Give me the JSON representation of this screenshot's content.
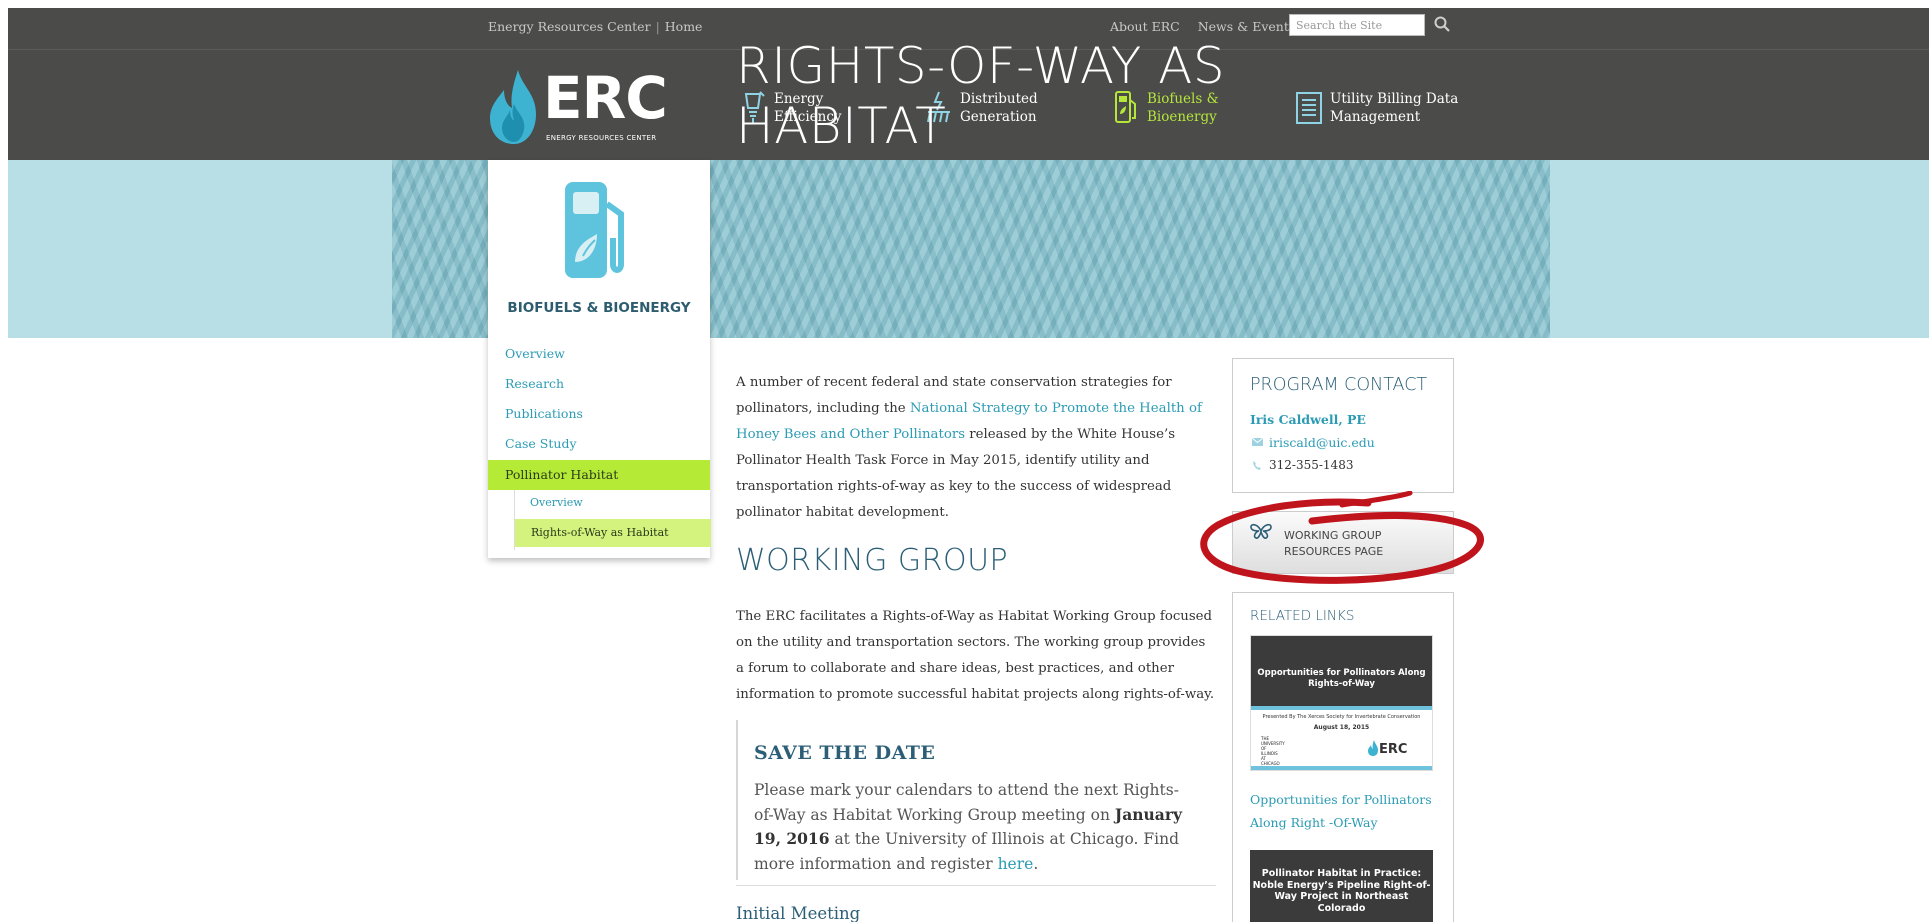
{
  "utility_bar": {
    "crumb_site": "Energy Resources Center",
    "crumb_sep": "|",
    "crumb_home": "Home",
    "link_about": "About ERC",
    "link_news": "News & Events",
    "search_placeholder": "Search the Site"
  },
  "logo": {
    "word": "ERC",
    "subtitle": "ENERGY RESOURCES CENTER"
  },
  "nav": [
    {
      "line1": "Energy",
      "line2": "Efficiency",
      "icon": "lightbulb-icon"
    },
    {
      "line1": "Distributed",
      "line2": "Generation",
      "icon": "power-grid-icon"
    },
    {
      "line1": "Biofuels &",
      "line2": "Bioenergy",
      "icon": "fuel-pump-icon",
      "active": true
    },
    {
      "line1": "Utility Billing Data",
      "line2": "Management",
      "icon": "document-icon"
    }
  ],
  "banner": {
    "title": "RIGHTS-OF-WAY AS HABITAT"
  },
  "sidebar": {
    "section": "BIOFUELS & BIOENERGY",
    "items": [
      "Overview",
      "Research",
      "Publications",
      "Case Study"
    ],
    "active_item": "Pollinator Habitat",
    "sub_items": [
      "Overview",
      "Rights-of-Way as Habitat"
    ]
  },
  "main": {
    "intro_before": "A number of recent federal and state conservation strategies for pollinators, including the ",
    "intro_link": "National Strategy to Promote the Health of Honey Bees and Other Pollinators",
    "intro_after": " released by the White House’s Pollinator Health Task Force in May 2015, identify utility and transportation rights-of-way as key to the success of widespread pollinator habitat development.",
    "heading": "WORKING GROUP",
    "paragraph": "The ERC facilitates a Rights-of-Way as Habitat Working Group focused on the utility and transportation sectors. The working group provides a forum to collaborate and share ideas, best practices, and other information to promote successful habitat projects along rights-of-way.",
    "save_title": "SAVE THE DATE",
    "save_before": "Please mark your calendars to attend the next Rights-of-Way as Habitat Working Group meeting on ",
    "save_date": "January 19, 2016",
    "save_middle": " at the University of Illinois at Chicago. Find more information and register ",
    "save_link": "here",
    "save_end": ".",
    "next_heading": "Initial Meeting"
  },
  "contact": {
    "title": "PROGRAM CONTACT",
    "name": "Iris Caldwell, PE",
    "email": "iriscald@uic.edu",
    "phone": "312-355-1483"
  },
  "resources_button": {
    "line1": "WORKING GROUP",
    "line2": "RESOURCES PAGE"
  },
  "related": {
    "title": "RELATED LINKS",
    "thumb1_title": "Opportunities for Pollinators Along Rights-of-Way",
    "thumb1_presented": "Presented By The Xerces Society for Invertebrate Conservation",
    "thumb1_date": "August 18, 2015",
    "thumb1_uic": "THE UNIVERSITY OF ILLINOIS AT CHICAGO",
    "thumb1_logo": "ERC",
    "link1": "Opportunities for Pollinators Along Right -Of-Way",
    "thumb2_title": "Pollinator Habitat in Practice: Noble Energy’s Pipeline Right-of-Way Project in Northeast Colorado"
  },
  "colors": {
    "header_bg": "#4b4b4a",
    "accent_green": "#b5eb37",
    "link_teal": "#2b9bb4",
    "heading_blue": "#2c5f77",
    "annotation_red": "#c0141c"
  }
}
